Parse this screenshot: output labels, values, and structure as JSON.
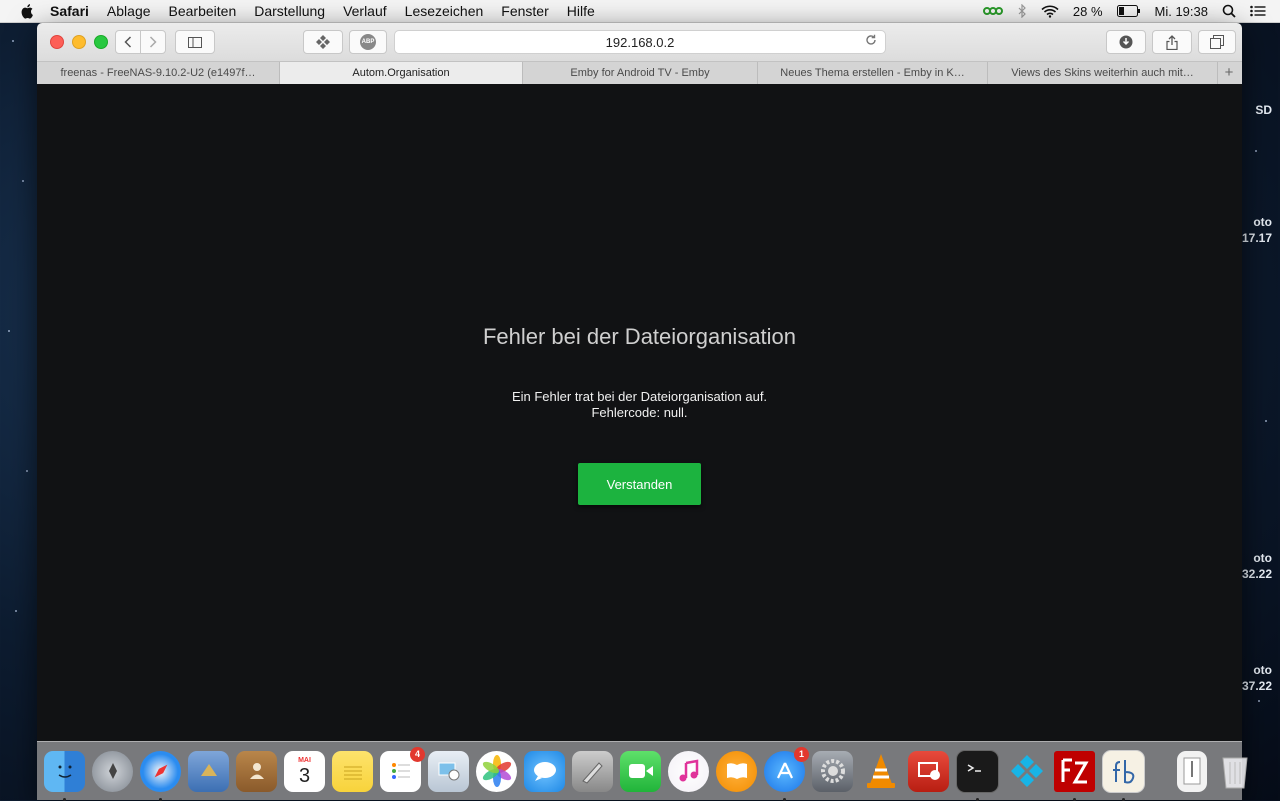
{
  "menubar": {
    "app": "Safari",
    "items": [
      "Ablage",
      "Bearbeiten",
      "Darstellung",
      "Verlauf",
      "Lesezeichen",
      "Fenster",
      "Hilfe"
    ],
    "battery": "28 %",
    "clock": "Mi. 19:38"
  },
  "desktop_peek": {
    "label_1": "SD",
    "label_2a": "oto",
    "label_2b": "17.17",
    "label_3a": "oto",
    "label_3b": "32.22",
    "label_4a": "oto",
    "label_4b": "37.22"
  },
  "browser": {
    "url": "192.168.0.2",
    "abp_label": "ABP",
    "tabs": [
      {
        "label": "freenas - FreeNAS-9.10.2-U2 (e1497f…",
        "active": false
      },
      {
        "label": "Autom.Organisation",
        "active": true
      },
      {
        "label": "Emby for Android TV - Emby",
        "active": false
      },
      {
        "label": "Neues Thema erstellen - Emby in K…",
        "active": false
      },
      {
        "label": "Views des Skins weiterhin auch mit…",
        "active": false
      }
    ]
  },
  "dialog": {
    "title": "Fehler bei der Dateiorganisation",
    "message_line1": "Ein Fehler trat bei der Dateiorganisation auf.",
    "message_line2": "Fehlercode: null.",
    "button": "Verstanden"
  },
  "dock": {
    "reminders_badge": "4",
    "appstore_badge": "1",
    "calendar_month": "MAI",
    "calendar_day": "3",
    "apps": [
      "finder",
      "launchpad",
      "safari",
      "mail-bird",
      "contacts",
      "calendar",
      "notes",
      "reminders",
      "preview",
      "photos",
      "messages",
      "xcode-tool",
      "facetime",
      "itunes",
      "ibooks",
      "app-store",
      "system-preferences",
      "vlc",
      "screen-sharing",
      "terminal",
      "kodi",
      "filezilla",
      "fb",
      "downloads-stack",
      "trash"
    ]
  },
  "colors": {
    "accent_button": "#1cb33f",
    "page_background": "#111214"
  }
}
